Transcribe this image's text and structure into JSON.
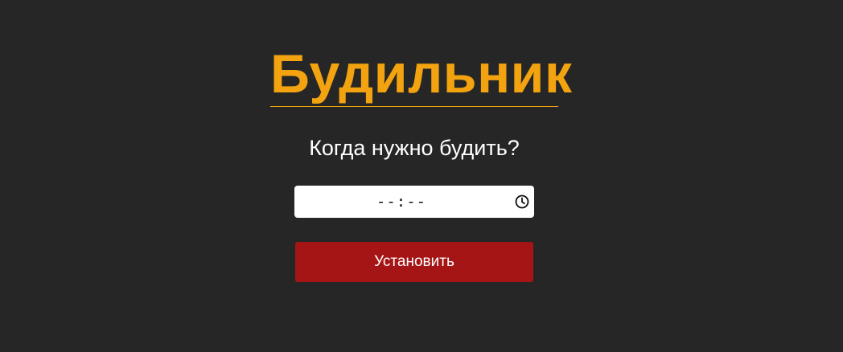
{
  "app": {
    "title": "Будильник",
    "question": "Когда нужно будить?"
  },
  "time_input": {
    "value": "--:--",
    "icon": "clock-icon"
  },
  "actions": {
    "set_label": "Установить"
  },
  "colors": {
    "background": "#262626",
    "title": "#f2a30f",
    "button": "#a51515",
    "text": "#ffffff"
  }
}
